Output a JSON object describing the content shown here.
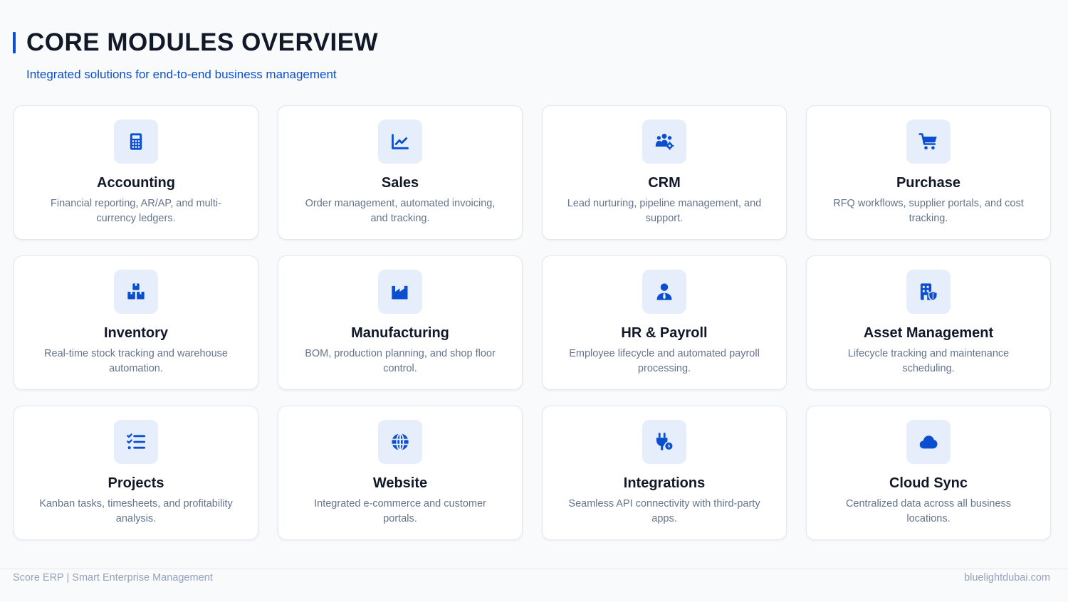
{
  "header": {
    "title": "CORE MODULES OVERVIEW",
    "subtitle": "Integrated solutions for end-to-end business management"
  },
  "colors": {
    "accent": "#0b4fd0",
    "icon_bg": "#e6eefc",
    "card_bg": "#ffffff",
    "page_bg": "#f8fafc"
  },
  "modules": [
    {
      "icon": "calculator-icon",
      "title": "Accounting",
      "desc": "Financial reporting, AR/AP, and multi-currency ledgers."
    },
    {
      "icon": "chart-line-icon",
      "title": "Sales",
      "desc": "Order management, automated invoicing, and tracking."
    },
    {
      "icon": "users-gear-icon",
      "title": "CRM",
      "desc": "Lead nurturing, pipeline management, and support."
    },
    {
      "icon": "cart-icon",
      "title": "Purchase",
      "desc": "RFQ workflows, supplier portals, and cost tracking."
    },
    {
      "icon": "boxes-icon",
      "title": "Inventory",
      "desc": "Real-time stock tracking and warehouse automation."
    },
    {
      "icon": "industry-icon",
      "title": "Manufacturing",
      "desc": "BOM, production planning, and shop floor control."
    },
    {
      "icon": "user-tie-icon",
      "title": "HR & Payroll",
      "desc": "Employee lifecycle and automated payroll processing."
    },
    {
      "icon": "building-shield-icon",
      "title": "Asset Management",
      "desc": "Lifecycle tracking and maintenance scheduling."
    },
    {
      "icon": "list-check-icon",
      "title": "Projects",
      "desc": "Kanban tasks, timesheets, and profitability analysis."
    },
    {
      "icon": "globe-icon",
      "title": "Website",
      "desc": "Integrated e-commerce and customer portals."
    },
    {
      "icon": "plug-bolt-icon",
      "title": "Integrations",
      "desc": "Seamless API connectivity with third-party apps."
    },
    {
      "icon": "cloud-icon",
      "title": "Cloud Sync",
      "desc": "Centralized data across all business locations."
    }
  ],
  "footer": {
    "left": "Score ERP | Smart Enterprise Management",
    "right": "bluelightdubai.com"
  }
}
